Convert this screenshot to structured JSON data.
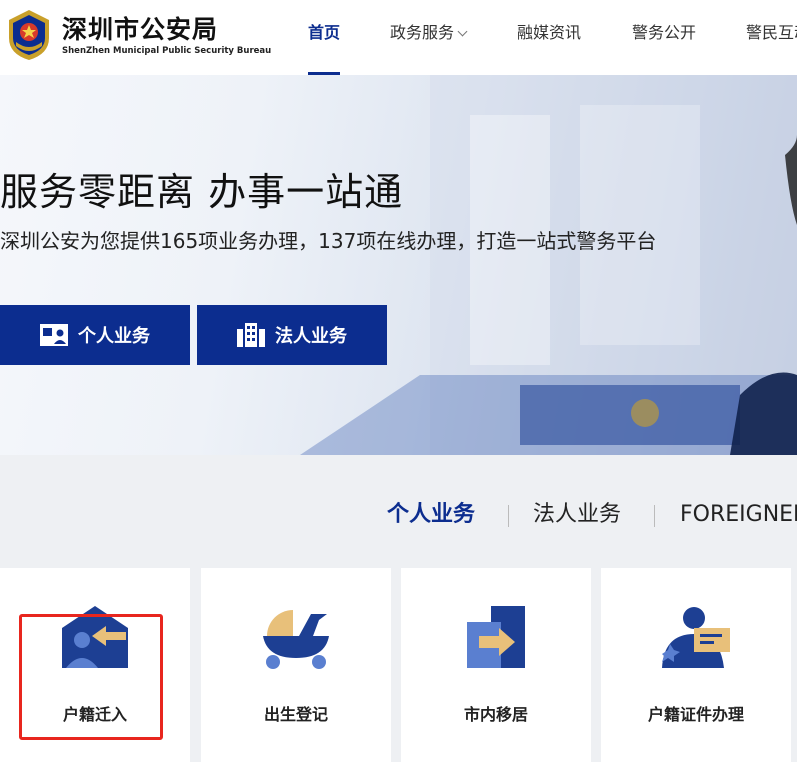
{
  "header": {
    "title": "深圳市公安局",
    "subtitle": "ShenZhen Municipal Public Security Bureau",
    "nav": [
      {
        "label": "首页"
      },
      {
        "label": "政务服务"
      },
      {
        "label": "融媒资讯"
      },
      {
        "label": "警务公开"
      },
      {
        "label": "警民互动"
      }
    ]
  },
  "hero": {
    "title": "服务零距离 办事一站通",
    "subtitle": "深圳公安为您提供165项业务办理，137项在线办理，打造一站式警务平台",
    "buttons": [
      {
        "label": "个人业务",
        "icon": "id-card-icon"
      },
      {
        "label": "法人业务",
        "icon": "building-icon"
      }
    ]
  },
  "business_tabs": [
    {
      "label": "个人业务"
    },
    {
      "label": "法人业务"
    },
    {
      "label": "FOREIGNER"
    }
  ],
  "cards": [
    {
      "label": "户籍迁入",
      "icon": "household-move-in-icon"
    },
    {
      "label": "出生登记",
      "icon": "birth-registration-icon"
    },
    {
      "label": "市内移居",
      "icon": "relocation-icon"
    },
    {
      "label": "户籍证件办理",
      "icon": "id-document-icon"
    }
  ],
  "colors": {
    "primary": "#0c2d8f",
    "accent": "#e8c07a",
    "highlight": "#e8261e"
  }
}
